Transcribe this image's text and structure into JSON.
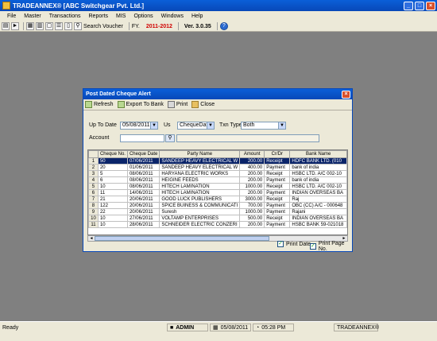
{
  "app": {
    "title": "TRADEANNEX® [ABC Switchgear Pvt. Ltd.]"
  },
  "menu": [
    "File",
    "Master",
    "Transactions",
    "Reports",
    "MIS",
    "Options",
    "Windows",
    "Help"
  ],
  "toolbar": {
    "search_voucher": "Search Voucher",
    "fy_label": "FY.",
    "fy_value": "2011-2012",
    "version": "Ver. 3.0.35"
  },
  "dialog": {
    "title": "Post Dated Cheque Alert",
    "tools": {
      "refresh": "Refresh",
      "export": "Export To Bank",
      "print": "Print",
      "close": "Close"
    },
    "filters": {
      "upto_label": "Up To Date",
      "upto_value": "05/08/2011",
      "us_label": "Us",
      "us_value": "ChequeDate",
      "txn_label": "Txn Type",
      "txn_value": "Both",
      "account_label": "Account",
      "account_value": ""
    },
    "grid": {
      "columns": [
        "Cheque No.",
        "Cheque Date",
        "Party Name",
        "Amount",
        "Cr/Dr",
        "Bank Name"
      ],
      "rows": [
        {
          "n": "1",
          "cheque": "50",
          "date": "07/06/2011",
          "party": "SANDEEP HEAVY ELECTRICAL W",
          "amount": "200.00",
          "crdr": "Receipt",
          "bank": "HDFC BANK LTD. (010"
        },
        {
          "n": "2",
          "cheque": "20",
          "date": "01/06/2011",
          "party": "SANDEEP HEAVY ELECTRICAL W",
          "amount": "400.00",
          "crdr": "Payment",
          "bank": "bank of india"
        },
        {
          "n": "3",
          "cheque": "5",
          "date": "08/06/2011",
          "party": "HARYANA ELECTRIC WORKS",
          "amount": "200.00",
          "crdr": "Receipt",
          "bank": "HSBC LTD. A/C 002-10"
        },
        {
          "n": "4",
          "cheque": "6",
          "date": "08/06/2011",
          "party": "HEIGINE FEEDS",
          "amount": "200.00",
          "crdr": "Payment",
          "bank": "bank of india"
        },
        {
          "n": "5",
          "cheque": "10",
          "date": "08/06/2011",
          "party": "HITECH LAMINATION",
          "amount": "1000.00",
          "crdr": "Receipt",
          "bank": "HSBC LTD. A/C 002-10"
        },
        {
          "n": "6",
          "cheque": "11",
          "date": "14/06/2011",
          "party": "HITECH LAMINATION",
          "amount": "200.00",
          "crdr": "Payment",
          "bank": "INDIAN OVERSEAS BA"
        },
        {
          "n": "7",
          "cheque": "21",
          "date": "20/06/2011",
          "party": "GOOD LUCK PUBLISHERS",
          "amount": "3000.00",
          "crdr": "Receipt",
          "bank": "Raj"
        },
        {
          "n": "8",
          "cheque": "122",
          "date": "20/06/2011",
          "party": "SPICE BUINESS & COMMUNICATI",
          "amount": "700.00",
          "crdr": "Payment",
          "bank": "OBC (CC) A/C - 000648"
        },
        {
          "n": "9",
          "cheque": "22",
          "date": "20/06/2011",
          "party": "Suresh",
          "amount": "1000.00",
          "crdr": "Payment",
          "bank": "Rajani"
        },
        {
          "n": "10",
          "cheque": "10",
          "date": "27/06/2011",
          "party": "VOLTAMP ENTERPRISES",
          "amount": "500.00",
          "crdr": "Receipt",
          "bank": "INDIAN OVERSEAS BA"
        },
        {
          "n": "11",
          "cheque": "10",
          "date": "28/06/2011",
          "party": "SCHNEIDER ELECTRIC CONZERI",
          "amount": "200.00",
          "crdr": "Payment",
          "bank": "HSBC BANK 59-021018"
        }
      ]
    },
    "checks": {
      "print_date": "Print Date",
      "print_page": "Print Page No."
    }
  },
  "status": {
    "ready": "Ready",
    "user": "ADMIN",
    "date": "05/08/2011",
    "time": "05:28 PM",
    "product": "TRADEANNEX®"
  }
}
